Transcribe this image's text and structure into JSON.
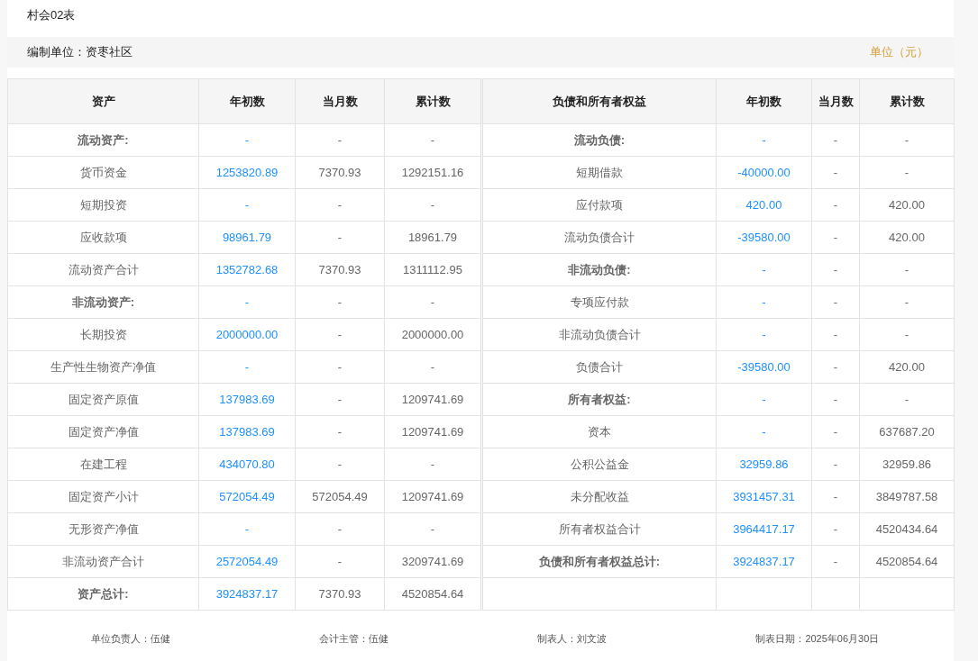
{
  "title": "村会02表",
  "info_bar": {
    "unit_label": "编制单位：资枣社区",
    "currency_note": "单位（元）"
  },
  "columns": {
    "left": [
      "资产",
      "年初数",
      "当月数",
      "累计数"
    ],
    "right": [
      "负债和所有者权益",
      "年初数",
      "当月数",
      "累计数"
    ]
  },
  "rows": [
    {
      "left": {
        "kind": "heading",
        "label": "流动资产:",
        "values": [
          "-",
          "-",
          "-"
        ]
      },
      "right": {
        "kind": "heading",
        "label": "流动负债:",
        "values": [
          "-",
          "-",
          "-"
        ]
      }
    },
    {
      "left": {
        "kind": "item",
        "label": "货币资金",
        "values": [
          "1253820.89",
          "7370.93",
          "1292151.16"
        ]
      },
      "right": {
        "kind": "item",
        "label": "短期借款",
        "values": [
          "-40000.00",
          "-",
          "-"
        ]
      }
    },
    {
      "left": {
        "kind": "item",
        "label": "短期投资",
        "values": [
          "-",
          "-",
          "-"
        ]
      },
      "right": {
        "kind": "item",
        "label": "应付款项",
        "values": [
          "420.00",
          "-",
          "420.00"
        ]
      }
    },
    {
      "left": {
        "kind": "item",
        "label": "应收款项",
        "values": [
          "98961.79",
          "-",
          "18961.79"
        ]
      },
      "right": {
        "kind": "item",
        "label": "流动负债合计",
        "values": [
          "-39580.00",
          "-",
          "420.00"
        ]
      }
    },
    {
      "left": {
        "kind": "item",
        "label": "流动资产合计",
        "values": [
          "1352782.68",
          "7370.93",
          "1311112.95"
        ]
      },
      "right": {
        "kind": "heading",
        "label": "非流动负债:",
        "values": [
          "-",
          "-",
          "-"
        ]
      }
    },
    {
      "left": {
        "kind": "heading",
        "label": "非流动资产:",
        "values": [
          "-",
          "-",
          "-"
        ]
      },
      "right": {
        "kind": "item",
        "label": "专项应付款",
        "values": [
          "-",
          "-",
          "-"
        ]
      }
    },
    {
      "left": {
        "kind": "item",
        "label": "长期投资",
        "values": [
          "2000000.00",
          "-",
          "2000000.00"
        ]
      },
      "right": {
        "kind": "item",
        "label": "非流动负债合计",
        "values": [
          "-",
          "-",
          "-"
        ]
      }
    },
    {
      "left": {
        "kind": "item",
        "label": "生产性生物资产净值",
        "values": [
          "-",
          "-",
          "-"
        ]
      },
      "right": {
        "kind": "item",
        "label": "负债合计",
        "values": [
          "-39580.00",
          "-",
          "420.00"
        ]
      }
    },
    {
      "left": {
        "kind": "item",
        "label": "固定资产原值",
        "values": [
          "137983.69",
          "-",
          "1209741.69"
        ]
      },
      "right": {
        "kind": "heading",
        "label": "所有者权益:",
        "values": [
          "-",
          "-",
          "-"
        ]
      }
    },
    {
      "left": {
        "kind": "item",
        "label": "固定资产净值",
        "values": [
          "137983.69",
          "-",
          "1209741.69"
        ]
      },
      "right": {
        "kind": "item",
        "label": "资本",
        "values": [
          "-",
          "-",
          "637687.20"
        ]
      }
    },
    {
      "left": {
        "kind": "item",
        "label": "在建工程",
        "values": [
          "434070.80",
          "-",
          "-"
        ]
      },
      "right": {
        "kind": "item",
        "label": "公积公益金",
        "values": [
          "32959.86",
          "-",
          "32959.86"
        ]
      }
    },
    {
      "left": {
        "kind": "item",
        "label": "固定资产小计",
        "values": [
          "572054.49",
          "572054.49",
          "1209741.69"
        ]
      },
      "right": {
        "kind": "item",
        "label": "未分配收益",
        "values": [
          "3931457.31",
          "-",
          "3849787.58"
        ]
      }
    },
    {
      "left": {
        "kind": "item",
        "label": "无形资产净值",
        "values": [
          "-",
          "-",
          "-"
        ]
      },
      "right": {
        "kind": "item",
        "label": "所有者权益合计",
        "values": [
          "3964417.17",
          "-",
          "4520434.64"
        ]
      }
    },
    {
      "left": {
        "kind": "item",
        "label": "非流动资产合计",
        "values": [
          "2572054.49",
          "-",
          "3209741.69"
        ]
      },
      "right": {
        "kind": "heading",
        "label": "负债和所有者权益总计:",
        "values": [
          "3924837.17",
          "-",
          "4520854.64"
        ]
      }
    },
    {
      "left": {
        "kind": "heading",
        "label": "资产总计:",
        "values": [
          "3924837.17",
          "7370.93",
          "4520854.64"
        ]
      }
    }
  ],
  "footer": [
    "单位负责人：伍健",
    "会计主管：伍健",
    "制表人：刘文波",
    "制表日期：2025年06月30日"
  ]
}
